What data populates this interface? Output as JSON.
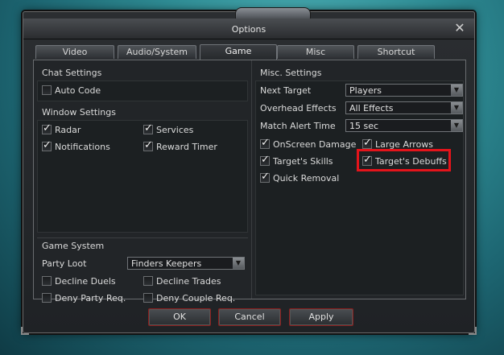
{
  "window": {
    "title": "Options"
  },
  "tabs": [
    {
      "label": "Video"
    },
    {
      "label": "Audio/System"
    },
    {
      "label": "Game",
      "active": true
    },
    {
      "label": "Misc"
    },
    {
      "label": "Shortcut"
    }
  ],
  "chat_settings": {
    "title": "Chat Settings",
    "auto_code": {
      "label": "Auto Code",
      "checked": false
    }
  },
  "window_settings": {
    "title": "Window Settings",
    "radar": {
      "label": "Radar",
      "checked": true
    },
    "services": {
      "label": "Services",
      "checked": true
    },
    "notifications": {
      "label": "Notifications",
      "checked": true
    },
    "reward_timer": {
      "label": "Reward Timer",
      "checked": true
    }
  },
  "game_system": {
    "title": "Game System",
    "party_loot_label": "Party Loot",
    "party_loot_value": "Finders Keepers",
    "decline_duels": {
      "label": "Decline Duels",
      "checked": false
    },
    "decline_trades": {
      "label": "Decline Trades",
      "checked": false
    },
    "deny_party_req": {
      "label": "Deny Party Req.",
      "checked": false
    },
    "deny_couple_req": {
      "label": "Deny Couple Req.",
      "checked": false
    }
  },
  "misc_settings": {
    "title": "Misc. Settings",
    "next_target_label": "Next Target",
    "next_target_value": "Players",
    "overhead_effects_label": "Overhead Effects",
    "overhead_effects_value": "All Effects",
    "match_alert_label": "Match Alert Time",
    "match_alert_value": "15 sec",
    "onscreen_damage": {
      "label": "OnScreen Damage",
      "checked": true
    },
    "large_arrows": {
      "label": "Large Arrows",
      "checked": true
    },
    "targets_skills": {
      "label": "Target's Skills",
      "checked": true
    },
    "targets_debuffs": {
      "label": "Target's Debuffs",
      "checked": true
    },
    "quick_removal": {
      "label": "Quick Removal",
      "checked": true
    }
  },
  "buttons": {
    "ok": "OK",
    "cancel": "Cancel",
    "apply": "Apply"
  },
  "icons": {
    "close": "close-icon",
    "check": "check-icon",
    "dropdown": "chevron-down-icon"
  },
  "colors": {
    "highlight": "#e4141b",
    "button_border": "#8a1e1e"
  }
}
